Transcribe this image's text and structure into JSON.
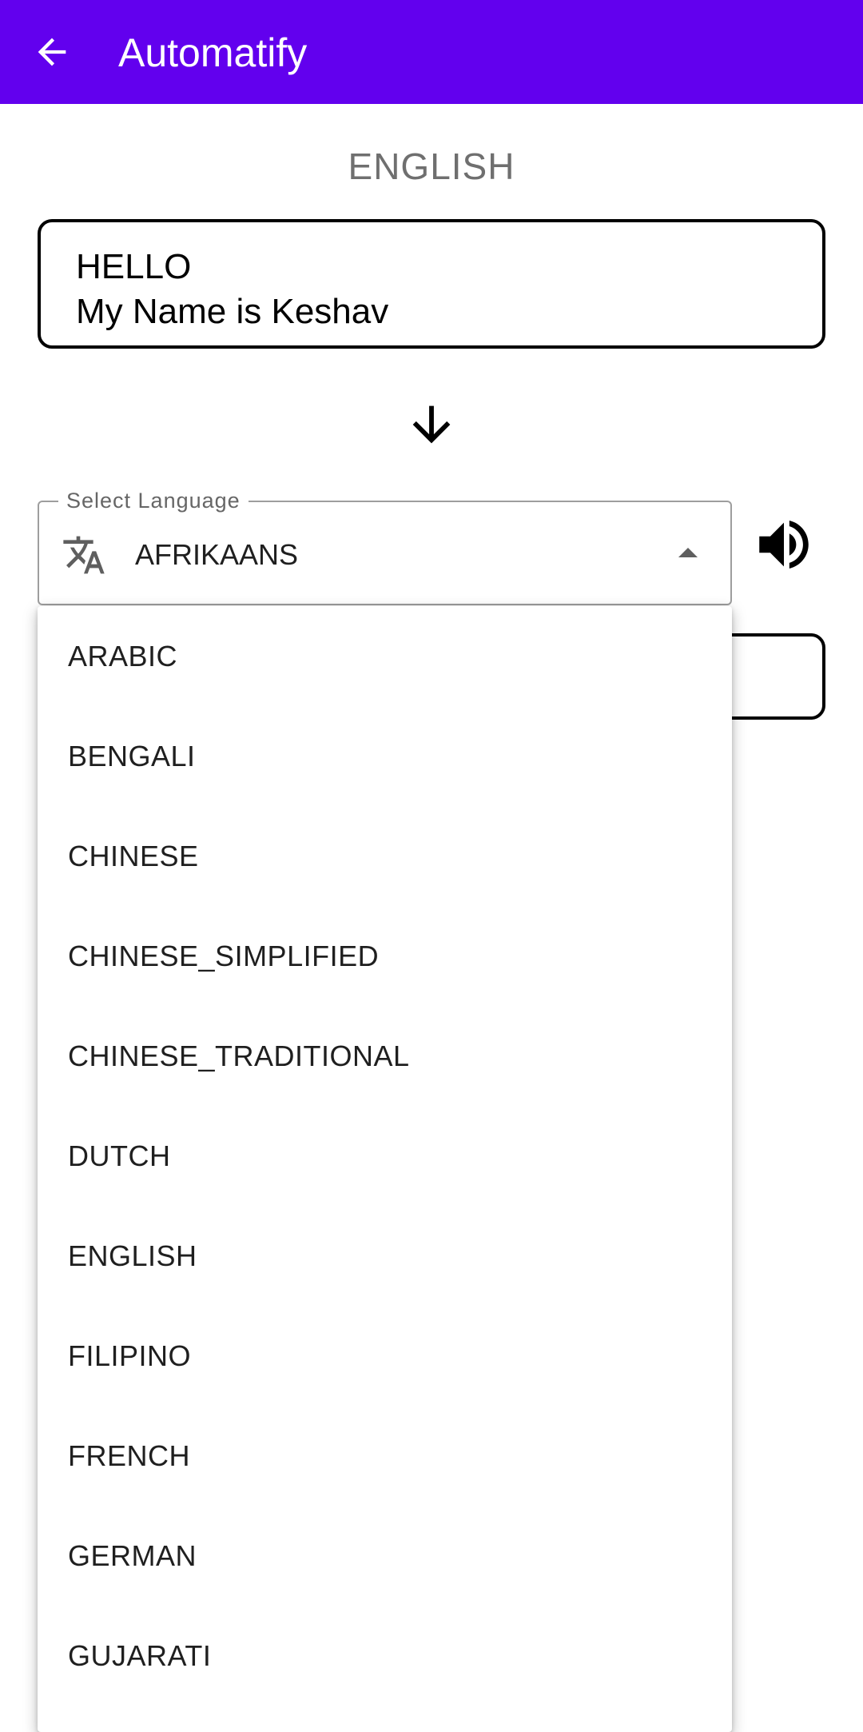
{
  "app_bar": {
    "title": "Automatify",
    "back_icon": "arrow-left-icon",
    "background": "#6200ee"
  },
  "source": {
    "language": "ENGLISH",
    "text_lines": [
      "HELLO",
      "My Name is Keshav"
    ]
  },
  "select": {
    "label": "Select Language",
    "value": "AFRIKAANS",
    "icon": "translate-icon",
    "expanded": true
  },
  "speaker_icon": "volume-up-icon",
  "dropdown": {
    "options": [
      "ARABIC",
      "BENGALI",
      "CHINESE",
      "CHINESE_SIMPLIFIED",
      "CHINESE_TRADITIONAL",
      "DUTCH",
      "ENGLISH",
      "FILIPINO",
      "FRENCH",
      "GERMAN",
      "GUJARATI"
    ]
  }
}
